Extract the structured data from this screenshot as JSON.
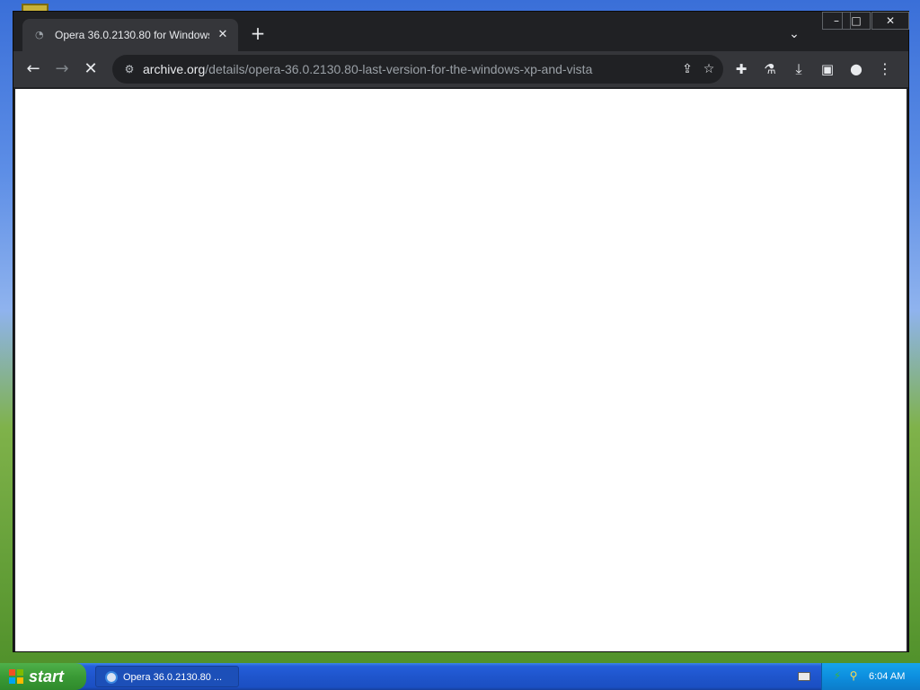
{
  "browser": {
    "tab": {
      "title": "Opera 36.0.2130.80 for Windows (",
      "close_glyph": "✕",
      "favicon": "loading-icon"
    },
    "new_tab_glyph": "+",
    "tab_search_glyph": "⌄",
    "window_controls": {
      "minimize": "–",
      "maximize": "□",
      "close": "✕"
    },
    "toolbar": {
      "back_glyph": "←",
      "forward_glyph": "→",
      "stop_glyph": "✕",
      "site_info_glyph": "⚙",
      "url_host": "archive.org",
      "url_path": "/details/opera-36.0.2130.80-last-version-for-the-windows-xp-and-vista",
      "share_glyph": "⇪",
      "bookmark_glyph": "☆",
      "extensions_glyph": "✚",
      "labs_glyph": "⚗",
      "download_glyph": "⤓",
      "side_panel_glyph": "▣",
      "profile_glyph": "●",
      "menu_glyph": "⋮"
    }
  },
  "taskbar": {
    "start_label": "start",
    "task_label": "Opera 36.0.2130.80 ...",
    "time": "6:04 AM",
    "tray_icons": [
      "network-icon",
      "search-icon"
    ],
    "colors": {
      "start_green": "#3a9a35",
      "taskbar_blue": "#245edb",
      "tray_blue": "#0d8fdf"
    }
  }
}
